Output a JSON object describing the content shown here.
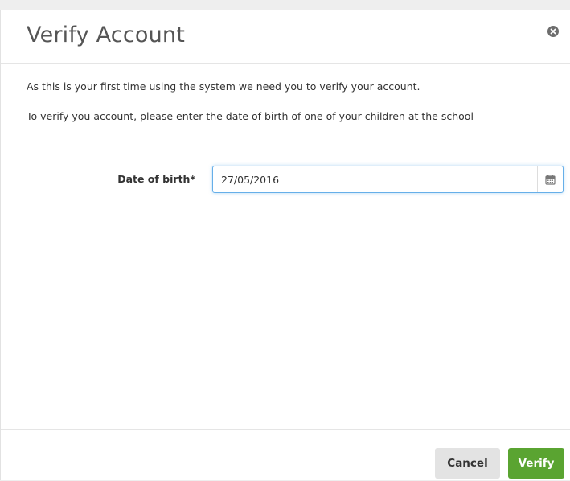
{
  "dialog": {
    "title": "Verify Account",
    "intro_line_1": "As this is your first time using the system we need you to verify your account.",
    "intro_line_2": "To verify you account, please enter the date of birth of one of your children at the school"
  },
  "form": {
    "dob_label": "Date of birth*",
    "dob_value": "27/05/2016"
  },
  "footer": {
    "cancel_label": "Cancel",
    "verify_label": "Verify"
  },
  "icons": {
    "close": "close-icon",
    "calendar": "calendar-icon"
  },
  "colors": {
    "verify_button": "#5aa431",
    "cancel_button": "#e3e3e3",
    "input_focus_border": "#66afe9"
  }
}
